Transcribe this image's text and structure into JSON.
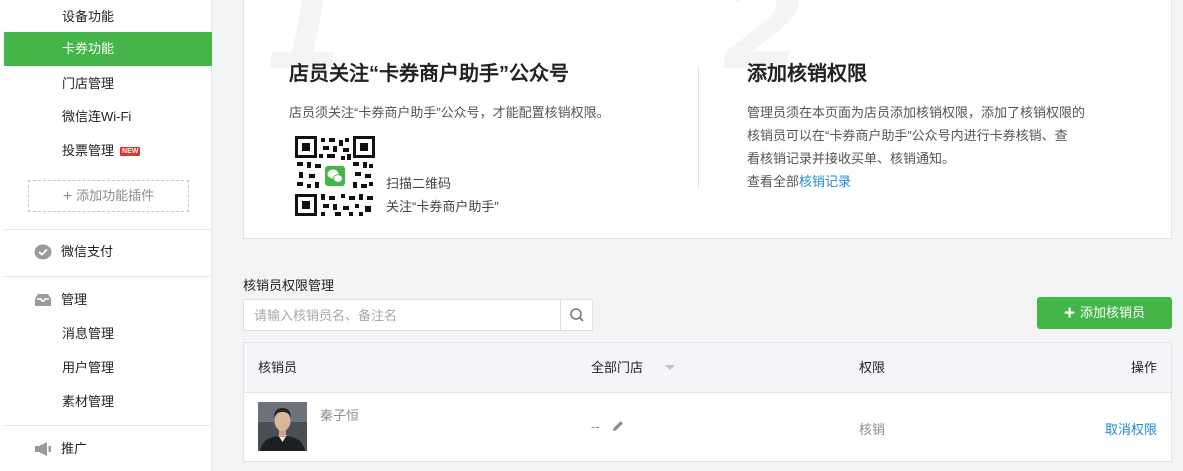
{
  "sidebar": {
    "items": [
      {
        "label": "设备功能"
      },
      {
        "label": "卡券功能"
      },
      {
        "label": "门店管理"
      },
      {
        "label": "微信连Wi-Fi"
      },
      {
        "label": "投票管理",
        "badge": "NEW"
      }
    ],
    "add_plugin_label": "添加功能插件",
    "groups": {
      "pay": {
        "label": "微信支付",
        "icon": "wechat-pay-icon"
      },
      "manage": {
        "label": "管理",
        "icon": "inbox-icon",
        "items": [
          {
            "label": "消息管理"
          },
          {
            "label": "用户管理"
          },
          {
            "label": "素材管理"
          }
        ]
      },
      "promote": {
        "label": "推广",
        "icon": "megaphone-icon"
      }
    },
    "accent_color": "#44b549"
  },
  "steps": {
    "step1": {
      "number": "1",
      "title": "店员关注“卡券商户助手”公众号",
      "desc": "店员须关注“卡券商户助手”公众号，才能配置核销权限。",
      "qr_line1": "扫描二维码",
      "qr_line2": "关注“卡券商户助手”"
    },
    "step2": {
      "number": "2",
      "title": "添加核销权限",
      "desc_line1": "管理员须在本页面为店员添加核销权限，添加了核销权限的",
      "desc_line2": "核销员可以在“卡券商户助手”公众号内进行卡券核销、查",
      "desc_line3": "看核销记录并接收买单、核销通知。",
      "desc_line4_prefix": "查看全部",
      "desc_line4_link": "核销记录"
    }
  },
  "manager": {
    "title": "核销员权限管理",
    "search_placeholder": "请输入核销员名、备注名",
    "add_button": "添加核销员",
    "columns": {
      "staff": "核销员",
      "store": "全部门店",
      "permission": "权限",
      "action": "操作"
    },
    "rows": [
      {
        "name": "秦子恒",
        "store": "--",
        "permission": "核销",
        "action": "取消权限"
      }
    ]
  }
}
